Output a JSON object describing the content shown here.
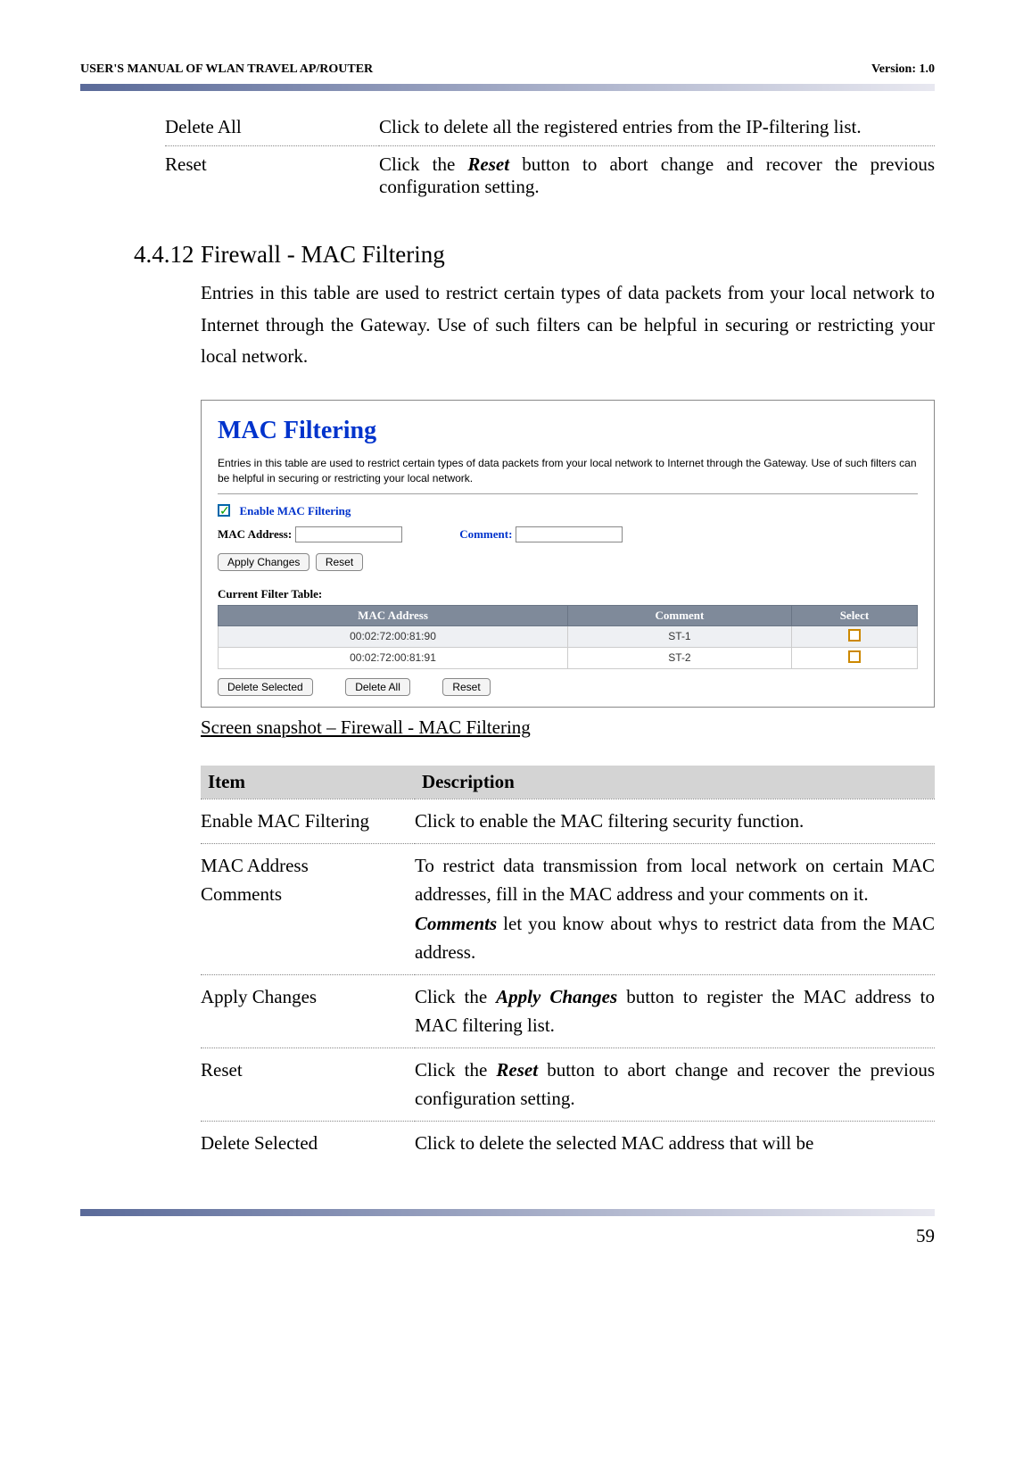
{
  "header": {
    "left": "USER'S MANUAL OF WLAN TRAVEL AP/ROUTER",
    "right": "Version: 1.0"
  },
  "top_table": {
    "rows": [
      {
        "label": "Delete All",
        "desc": "Click to delete all the registered entries from the IP-filtering list."
      },
      {
        "label": "Reset",
        "desc_pre": "Click the ",
        "desc_bold": "Reset",
        "desc_post": " button to abort change and recover the previous configuration setting."
      }
    ]
  },
  "section": {
    "number": "4.4.12",
    "title": "Firewall - MAC Filtering",
    "body": "Entries in this table are used to restrict certain types of data packets from your local network to Internet through the Gateway. Use of such filters can be helpful in securing or restricting your local network."
  },
  "mac_box": {
    "title": "MAC Filtering",
    "desc": "Entries in this table are used to restrict certain types of data packets from your local network to Internet through the Gateway. Use of such filters can be helpful in securing or restricting your local network.",
    "enable_label": "Enable MAC Filtering",
    "mac_address_label": "MAC Address:",
    "comment_label": "Comment:",
    "apply_btn": "Apply Changes",
    "reset_btn": "Reset",
    "table_label": "Current Filter Table:",
    "table_headers": [
      "MAC Address",
      "Comment",
      "Select"
    ],
    "table_rows": [
      {
        "mac": "00:02:72:00:81:90",
        "comment": "ST-1"
      },
      {
        "mac": "00:02:72:00:81:91",
        "comment": "ST-2"
      }
    ],
    "delete_selected_btn": "Delete Selected",
    "delete_all_btn": "Delete All",
    "reset2_btn": "Reset"
  },
  "caption": "Screen snapshot – Firewall - MAC Filtering",
  "desc_table": {
    "header_item": "Item",
    "header_desc": "Description",
    "rows": [
      {
        "label": "Enable MAC Filtering",
        "desc": "Click to enable the MAC filtering security function."
      },
      {
        "label1": "MAC Address",
        "label2": "Comments",
        "desc1": "To restrict data transmission from local network on certain MAC addresses, fill in the MAC address and your comments on it.",
        "desc2_bold": "Comments",
        "desc2_post": " let you know about whys to restrict data from the MAC address."
      },
      {
        "label": "Apply Changes",
        "desc_pre": "Click the ",
        "desc_bold": "Apply Changes",
        "desc_post": " button to register the MAC address to MAC filtering list."
      },
      {
        "label": "Reset",
        "desc_pre": "Click the ",
        "desc_bold": "Reset",
        "desc_post": " button to abort change and recover the previous configuration setting."
      },
      {
        "label": "Delete Selected",
        "desc": "Click to delete the selected MAC address that will be"
      }
    ]
  },
  "page_number": "59"
}
